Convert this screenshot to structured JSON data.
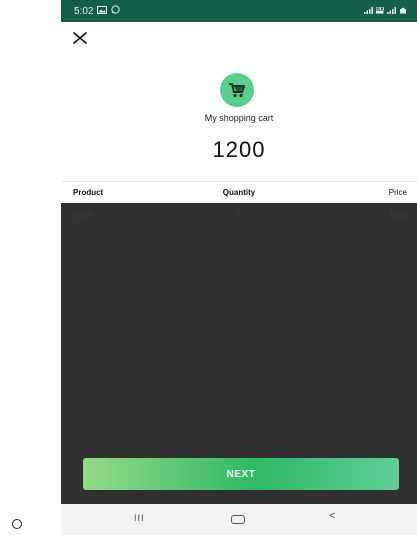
{
  "status_bar": {
    "time": "5:02"
  },
  "header": {
    "close_icon": "close-icon",
    "cart_icon": "shopping-cart-icon"
  },
  "cart": {
    "title": "My shopping cart",
    "total": "1200"
  },
  "table": {
    "headers": {
      "product": "Product",
      "quantity": "Quantity",
      "price": "Price"
    },
    "rows": [
      {
        "product": "Tshirt",
        "quantity": "1",
        "price": "1200"
      }
    ]
  },
  "actions": {
    "next_label": "NEXT"
  },
  "nav_bar": {
    "recent": "III",
    "back": "<"
  },
  "colors": {
    "status_bar": "#135e48",
    "cart_circle": "#56cf8c",
    "dark_panel": "#303030",
    "button_start": "#93da86",
    "button_mid": "#2fb865",
    "button_end": "#5fcf96"
  }
}
